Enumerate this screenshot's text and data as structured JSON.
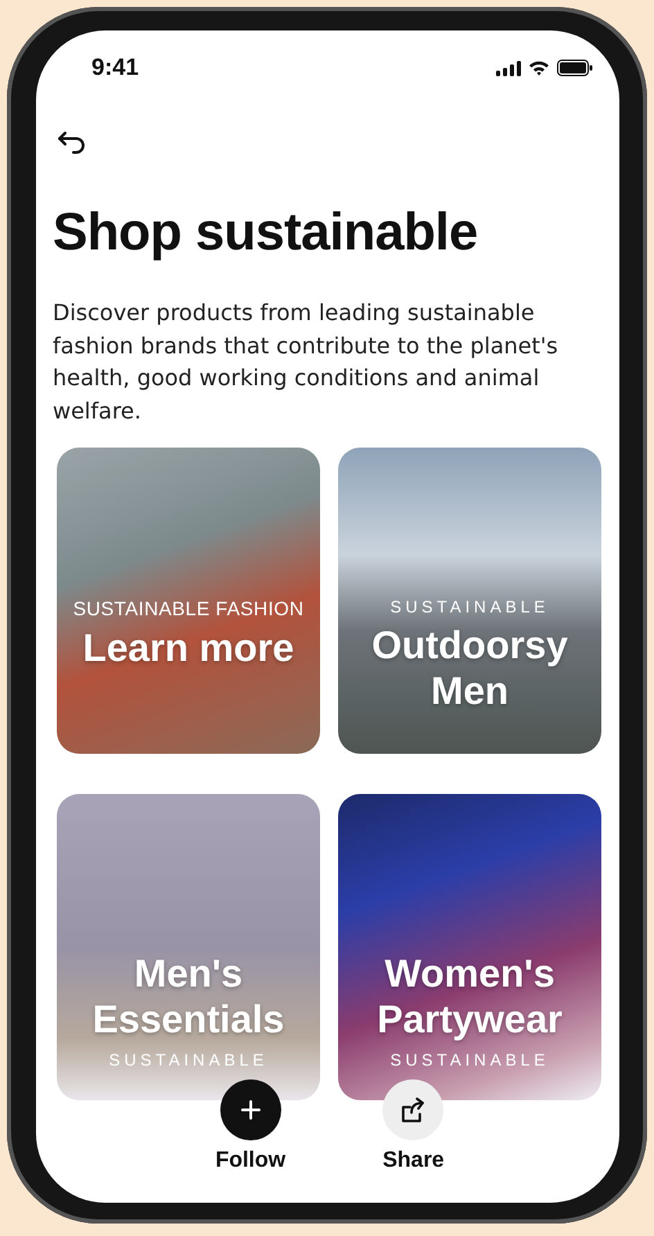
{
  "status_bar": {
    "time": "9:41"
  },
  "title": "Shop sustainable",
  "description": "Discover products from leading sustainable fashion brands that contribute to the planet's health, good working conditions and animal welfare.",
  "cards": [
    {
      "kind": "eyebrow-top",
      "eyebrow": "SUSTAINABLE FASHION",
      "title": "Learn more"
    },
    {
      "kind": "eyebrow-top",
      "eyebrow": "SUSTAINABLE",
      "title": "Outdoorsy Men"
    },
    {
      "kind": "eyebrow-bottom",
      "eyebrow": "SUSTAINABLE",
      "title": "Men's Essentials"
    },
    {
      "kind": "eyebrow-bottom",
      "eyebrow": "SUSTAINABLE",
      "title": "Women's Partywear"
    }
  ],
  "actions": [
    {
      "kind": "follow",
      "label": "Follow"
    },
    {
      "kind": "share",
      "label": "Share"
    }
  ]
}
